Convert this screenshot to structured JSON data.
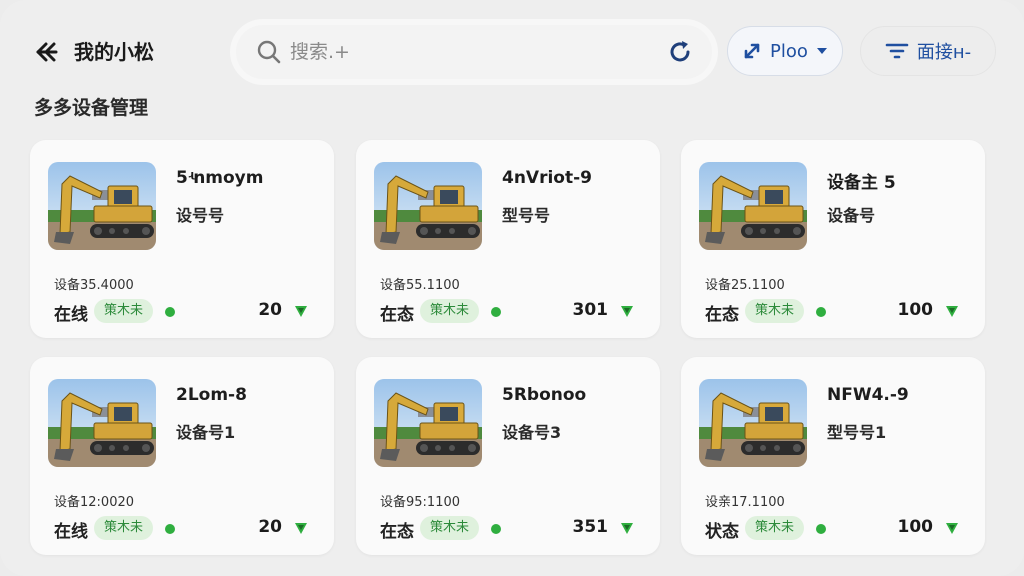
{
  "header": {
    "title": "我的小松",
    "search_placeholder": "搜索.+",
    "sort_label": "Ploo",
    "filter_label": "面接н-"
  },
  "section": {
    "title": "多多设备管理"
  },
  "colors": {
    "accent": "#1f4fa0",
    "online": "#2fae3f",
    "tag_bg": "#dff1dd"
  },
  "cards": [
    {
      "name": "5ʵnmoym",
      "model": "设号号",
      "device_id": "设备35.4000",
      "status": "在线",
      "tag": "策木未",
      "signal": "20"
    },
    {
      "name": "4nVriot-9",
      "model": "型号号",
      "device_id": "设备55.1100",
      "status": "在态",
      "tag": "策木未",
      "signal": "301"
    },
    {
      "name": "设备主 5",
      "model": "设备号",
      "device_id": "设备25.1100",
      "status": "在态",
      "tag": "策木未",
      "signal": "100"
    },
    {
      "name": "2Lom-8",
      "model": "设备号1",
      "device_id": "设备12:0020",
      "status": "在线",
      "tag": "策木未",
      "signal": "20"
    },
    {
      "name": "5Rbonoo",
      "model": "设备号3",
      "device_id": "设备95:1100",
      "status": "在态",
      "tag": "策木未",
      "signal": "351"
    },
    {
      "name": "NFW4.-9",
      "model": "型号号1",
      "device_id": "设亲17.1100",
      "status": "状态",
      "tag": "策木未",
      "signal": "100"
    }
  ]
}
